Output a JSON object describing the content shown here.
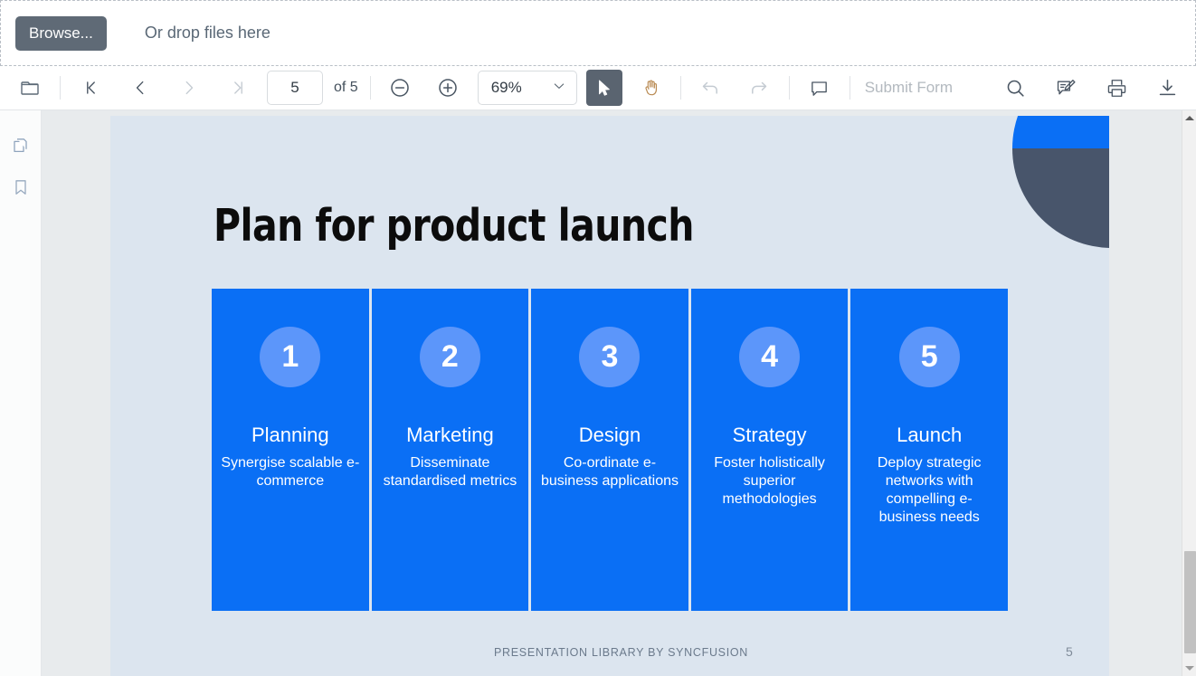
{
  "dropzone": {
    "browse_label": "Browse...",
    "hint": "Or drop files here"
  },
  "toolbar": {
    "open_icon": "folder-icon",
    "first_page_icon": "first-page-icon",
    "previous_page_icon": "previous-page-icon",
    "next_page_icon": "next-page-icon",
    "last_page_icon": "last-page-icon",
    "page_number": "5",
    "page_total": "of 5",
    "zoom_out_icon": "zoom-out-icon",
    "zoom_in_icon": "zoom-in-icon",
    "zoom_value": "69%",
    "select_tool_icon": "cursor-arrow-icon",
    "pan_tool_icon": "hand-icon",
    "undo_icon": "undo-icon",
    "redo_icon": "redo-icon",
    "comment_icon": "comment-icon",
    "submit_form_label": "Submit Form",
    "search_icon": "search-icon",
    "annotation_icon": "annotation-edit-icon",
    "print_icon": "print-icon",
    "download_icon": "download-icon"
  },
  "sidebar": {
    "thumbnails_icon": "page-thumbnails-icon",
    "bookmarks_icon": "bookmark-icon"
  },
  "slide": {
    "title": "Plan for product launch",
    "footer": "PRESENTATION LIBRARY BY SYNCFUSION",
    "page_number": "5",
    "cards": [
      {
        "number": "1",
        "title": "Planning",
        "description": "Synergise scalable e-commerce"
      },
      {
        "number": "2",
        "title": "Marketing",
        "description": "Disseminate standardised metrics"
      },
      {
        "number": "3",
        "title": "Design",
        "description": "Co-ordinate e-business applications"
      },
      {
        "number": "4",
        "title": "Strategy",
        "description": "Foster holistically superior methodologies"
      },
      {
        "number": "5",
        "title": "Launch",
        "description": "Deploy strategic networks with compelling e-business needs"
      }
    ]
  },
  "colors": {
    "card_blue": "#0a6ff5",
    "circle_blue": "#5c96fa",
    "slide_background": "#dce5ef",
    "viewer_background": "#e8ebed",
    "deco_blue": "#0a6ff5",
    "deco_slate": "#48556b",
    "browse_button": "#5f6a76",
    "active_tool": "#5a6470"
  }
}
